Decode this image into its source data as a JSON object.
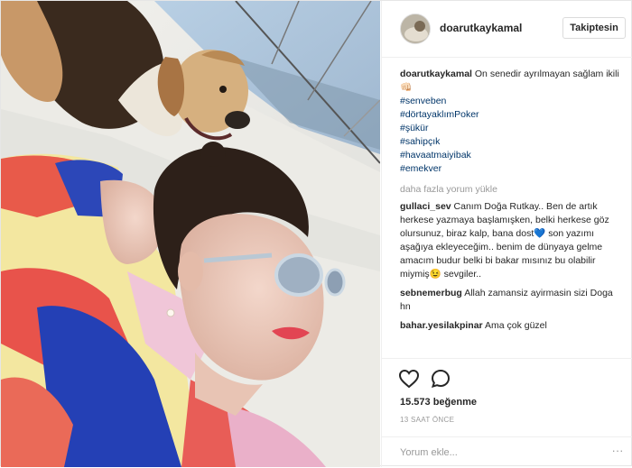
{
  "post": {
    "username": "doarutkaykamal",
    "follow_label": "Takiptesin",
    "caption": {
      "username": "doarutkaykamal",
      "text": "On senedir ayrılmayan sağlam ikili👊🏻",
      "hashtags": [
        "#senveben",
        "#dörtayaklımPoker",
        "#şükür",
        "#sahipçık",
        "#havaatmaiyibak",
        "#emekver"
      ]
    },
    "load_more_label": "daha fazla yorum yükle",
    "comments": [
      {
        "username": "gullaci_sev",
        "text": "Canım Doğa Rutkay.. Ben de artık herkese yazmaya başlamışken, belki herkese göz olursunuz, biraz kalp, bana dost💙 son yazımı aşağıya ekleyeceğim.. benim de dünyaya gelme amacım budur belki bi bakar mısınız bu olabilir miymiş😉 sevgiler.."
      },
      {
        "username": "sebnemerbug",
        "text": "Allah zamansiz ayirmasin sizi Doga hn"
      },
      {
        "username": "bahar.yesilakpinar",
        "text": "Ama çok güzel"
      }
    ],
    "likes": "15.573 beğenme",
    "time": "13 SAAT ÖNCE",
    "add_comment_placeholder": "Yorum ekle...",
    "more_glyph": "···"
  }
}
